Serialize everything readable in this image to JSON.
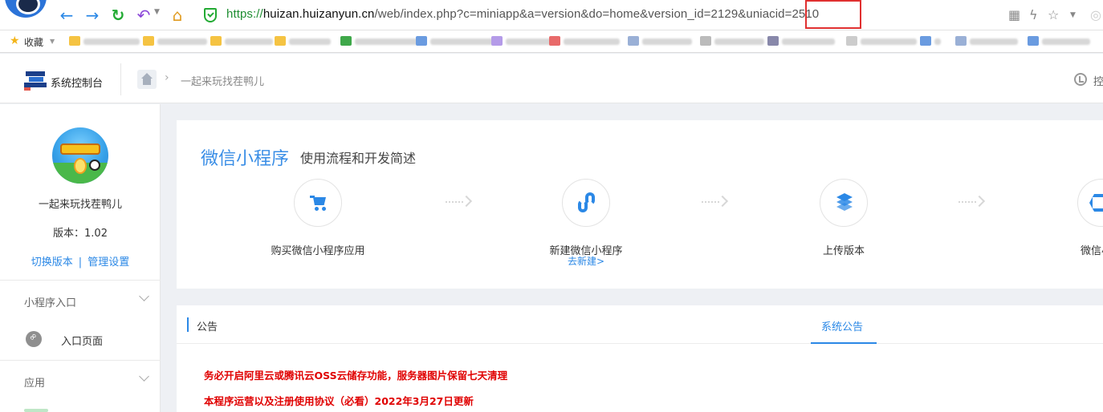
{
  "browser": {
    "url_protocol": "https://",
    "url_host": "huizan.huizanyun.cn",
    "url_path": "/web/index.php?c=miniapp&a=version&do=home&version_id=2129&uniacid=",
    "url_highlight": "2510"
  },
  "bookmarks": {
    "favorites_label": "收藏",
    "items": [
      {
        "icon": "folder-icon",
        "color": "#f5c342"
      },
      {
        "icon": "folder-icon",
        "color": "#f5c342"
      },
      {
        "icon": "folder-icon",
        "color": "#f5c342"
      },
      {
        "icon": "folder-icon",
        "color": "#f5c342"
      },
      {
        "icon": "site-icon",
        "color": "#3fa84a"
      },
      {
        "icon": "site-icon",
        "color": "#6a9be0"
      },
      {
        "icon": "site-icon",
        "color": "#b49be8"
      },
      {
        "icon": "site-icon",
        "color": "#e86a6a"
      },
      {
        "icon": "site-icon",
        "color": "#9ab0d6"
      },
      {
        "icon": "site-icon",
        "color": "#bbbbbb"
      },
      {
        "icon": "site-icon",
        "color": "#8888aa"
      },
      {
        "icon": "site-icon",
        "color": "#cccccc"
      },
      {
        "icon": "site-icon",
        "color": "#6a9be0"
      },
      {
        "icon": "site-icon",
        "color": "#9ab0d6"
      },
      {
        "icon": "site-icon",
        "color": "#6a9be0"
      }
    ]
  },
  "header": {
    "logo_text": "系统控制台",
    "breadcrumb_current": "一起来玩找茬鸭儿",
    "right_label": "控"
  },
  "sidebar": {
    "app_name": "一起来玩找茬鸭儿",
    "version_text": "版本：1.02",
    "switch_version": "切换版本",
    "separator": "|",
    "manage_settings": "管理设置",
    "group_entry": "小程序入口",
    "entry_page": "入口页面",
    "group_app": "应用"
  },
  "process": {
    "title": "微信小程序",
    "subtitle": "使用流程和开发简述",
    "steps": [
      {
        "label": "购买微信小程序应用",
        "icon": "cart-icon"
      },
      {
        "label": "新建微信小程序",
        "link": "去新建>",
        "icon": "link-icon"
      },
      {
        "label": "上传版本",
        "icon": "layers-icon"
      },
      {
        "label": "微信小程",
        "icon": "hexagon-icon"
      }
    ]
  },
  "notice": {
    "title": "公告",
    "tab": "系统公告",
    "lines": [
      "务必开启阿里云或腾讯云OSS云储存功能，服务器图片保留七天清理",
      "本程序运营以及注册使用协议（必看）2022年3月27日更新"
    ]
  },
  "colors": {
    "accent": "#2b88e6",
    "notice_red": "#e00000",
    "url_highlight_box": "#e03030"
  }
}
